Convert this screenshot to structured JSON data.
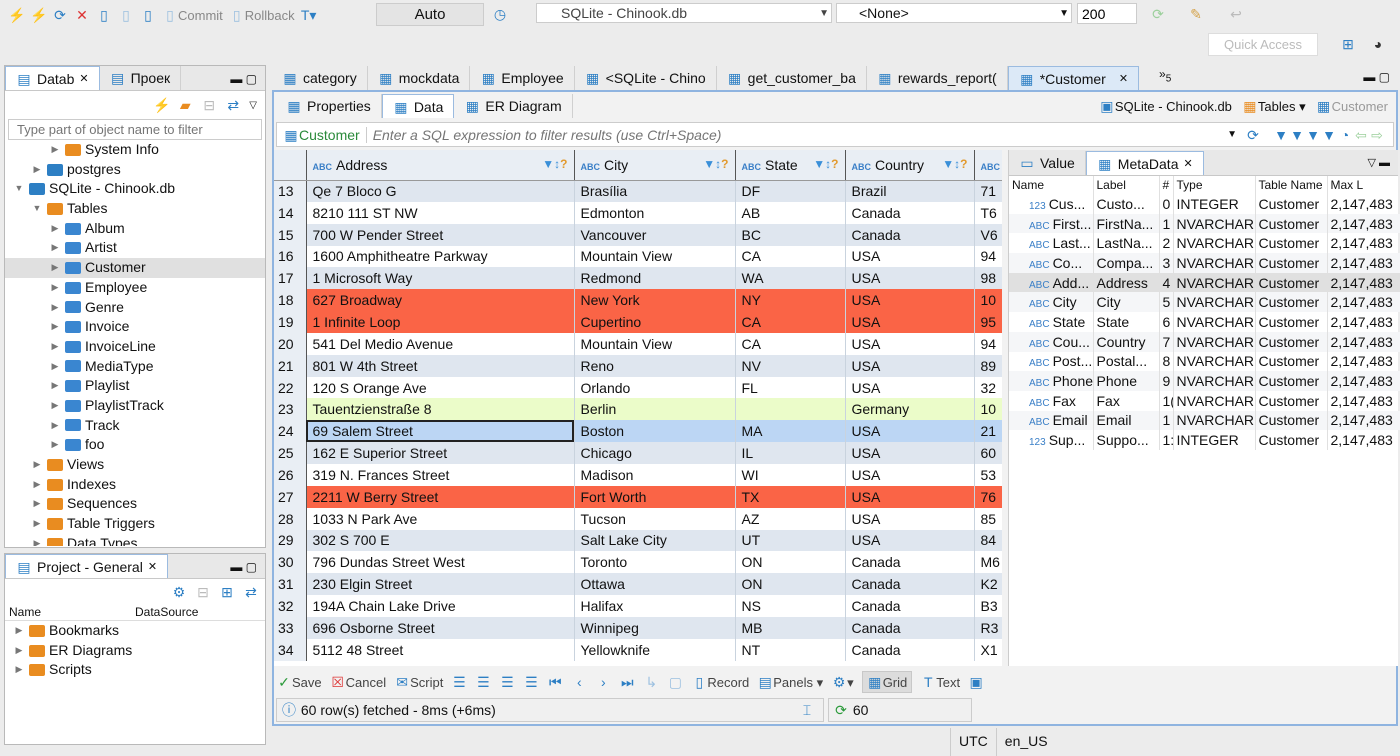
{
  "toolbar": {
    "commit": "Commit",
    "rollback": "Rollback",
    "mode": "Auto",
    "datasource": "SQLite - Chinook.db",
    "schema": "<None>",
    "limit": "200",
    "quick_access": "Quick Access"
  },
  "navigator": {
    "tab1": "Datab",
    "tab2": "Проек",
    "filter_placeholder": "Type part of object name to filter",
    "tree": [
      {
        "label": "System Info",
        "level": 2,
        "icon": "folder",
        "exp": "▶"
      },
      {
        "label": "postgres",
        "level": 1,
        "icon": "db",
        "exp": "▶"
      },
      {
        "label": "SQLite - Chinook.db",
        "level": 0,
        "icon": "db",
        "exp": "▼"
      },
      {
        "label": "Tables",
        "level": 1,
        "icon": "folder",
        "exp": "▼"
      },
      {
        "label": "Album",
        "level": 2,
        "icon": "table",
        "exp": "▶"
      },
      {
        "label": "Artist",
        "level": 2,
        "icon": "table",
        "exp": "▶"
      },
      {
        "label": "Customer",
        "level": 2,
        "icon": "table",
        "exp": "▶",
        "selected": true
      },
      {
        "label": "Employee",
        "level": 2,
        "icon": "table",
        "exp": "▶"
      },
      {
        "label": "Genre",
        "level": 2,
        "icon": "table",
        "exp": "▶"
      },
      {
        "label": "Invoice",
        "level": 2,
        "icon": "table",
        "exp": "▶"
      },
      {
        "label": "InvoiceLine",
        "level": 2,
        "icon": "table",
        "exp": "▶"
      },
      {
        "label": "MediaType",
        "level": 2,
        "icon": "table",
        "exp": "▶"
      },
      {
        "label": "Playlist",
        "level": 2,
        "icon": "table",
        "exp": "▶"
      },
      {
        "label": "PlaylistTrack",
        "level": 2,
        "icon": "table",
        "exp": "▶"
      },
      {
        "label": "Track",
        "level": 2,
        "icon": "table",
        "exp": "▶"
      },
      {
        "label": "foo",
        "level": 2,
        "icon": "table",
        "exp": "▶"
      },
      {
        "label": "Views",
        "level": 1,
        "icon": "view",
        "exp": "▶"
      },
      {
        "label": "Indexes",
        "level": 1,
        "icon": "folder",
        "exp": "▶"
      },
      {
        "label": "Sequences",
        "level": 1,
        "icon": "folder",
        "exp": "▶"
      },
      {
        "label": "Table Triggers",
        "level": 1,
        "icon": "folder",
        "exp": "▶"
      },
      {
        "label": "Data Types",
        "level": 1,
        "icon": "folder",
        "exp": "▶"
      }
    ]
  },
  "project": {
    "title": "Project - General",
    "col_name": "Name",
    "col_ds": "DataSource",
    "items": [
      "Bookmarks",
      "ER Diagrams",
      "Scripts"
    ]
  },
  "editor_tabs": [
    "category",
    "mockdata",
    "Employee",
    "<SQLite - Chino",
    "get_customer_ba",
    "rewards_report(",
    "*Customer"
  ],
  "editor_tabs_more": "5",
  "subtabs": [
    "Properties",
    "Data",
    "ER Diagram"
  ],
  "subtab_right": {
    "ds": "SQLite - Chinook.db",
    "tables": "Tables",
    "entity": "Customer"
  },
  "filter": {
    "entity": "Customer",
    "placeholder": "Enter a SQL expression to filter results (use Ctrl+Space)"
  },
  "grid": {
    "columns": [
      "Address",
      "City",
      "State",
      "Country",
      ""
    ],
    "row_colors": {
      "red": "#fa6446",
      "green": "#ebfcc9",
      "selected": "#bcd6f4"
    },
    "rows": [
      {
        "n": "13",
        "c": [
          "Qe 7 Bloco G",
          "Brasília",
          "DF",
          "Brazil",
          "71"
        ]
      },
      {
        "n": "14",
        "c": [
          "8210 111 ST NW",
          "Edmonton",
          "AB",
          "Canada",
          "T6"
        ]
      },
      {
        "n": "15",
        "c": [
          "700 W Pender Street",
          "Vancouver",
          "BC",
          "Canada",
          "V6"
        ]
      },
      {
        "n": "16",
        "c": [
          "1600 Amphitheatre Parkway",
          "Mountain View",
          "CA",
          "USA",
          "94"
        ]
      },
      {
        "n": "17",
        "c": [
          "1 Microsoft Way",
          "Redmond",
          "WA",
          "USA",
          "98"
        ]
      },
      {
        "n": "18",
        "c": [
          "627 Broadway",
          "New York",
          "NY",
          "USA",
          "10"
        ],
        "hl": "red"
      },
      {
        "n": "19",
        "c": [
          "1 Infinite Loop",
          "Cupertino",
          "CA",
          "USA",
          "95"
        ],
        "hl": "red"
      },
      {
        "n": "20",
        "c": [
          "541 Del Medio Avenue",
          "Mountain View",
          "CA",
          "USA",
          "94"
        ]
      },
      {
        "n": "21",
        "c": [
          "801 W 4th Street",
          "Reno",
          "NV",
          "USA",
          "89"
        ]
      },
      {
        "n": "22",
        "c": [
          "120 S Orange Ave",
          "Orlando",
          "FL",
          "USA",
          "32"
        ]
      },
      {
        "n": "23",
        "c": [
          "Tauentzienstraße 8",
          "Berlin",
          "",
          "Germany",
          "10"
        ],
        "hl": "green"
      },
      {
        "n": "24",
        "c": [
          "69 Salem Street",
          "Boston",
          "MA",
          "USA",
          "21"
        ],
        "hl": "selr"
      },
      {
        "n": "25",
        "c": [
          "162 E Superior Street",
          "Chicago",
          "IL",
          "USA",
          "60"
        ]
      },
      {
        "n": "26",
        "c": [
          "319 N. Frances Street",
          "Madison",
          "WI",
          "USA",
          "53"
        ]
      },
      {
        "n": "27",
        "c": [
          "2211 W Berry Street",
          "Fort Worth",
          "TX",
          "USA",
          "76"
        ],
        "hl": "red"
      },
      {
        "n": "28",
        "c": [
          "1033 N Park Ave",
          "Tucson",
          "AZ",
          "USA",
          "85"
        ]
      },
      {
        "n": "29",
        "c": [
          "302 S 700 E",
          "Salt Lake City",
          "UT",
          "USA",
          "84"
        ]
      },
      {
        "n": "30",
        "c": [
          "796 Dundas Street West",
          "Toronto",
          "ON",
          "Canada",
          "M6"
        ]
      },
      {
        "n": "31",
        "c": [
          "230 Elgin Street",
          "Ottawa",
          "ON",
          "Canada",
          "K2"
        ]
      },
      {
        "n": "32",
        "c": [
          "194A Chain Lake Drive",
          "Halifax",
          "NS",
          "Canada",
          "B3"
        ]
      },
      {
        "n": "33",
        "c": [
          "696 Osborne Street",
          "Winnipeg",
          "MB",
          "Canada",
          "R3"
        ]
      },
      {
        "n": "34",
        "c": [
          "5112 48 Street",
          "Yellowknife",
          "NT",
          "Canada",
          "X1"
        ]
      }
    ]
  },
  "side_panel": {
    "tab_value": "Value",
    "tab_meta": "MetaData",
    "columns": [
      "Name",
      "Label",
      "#",
      "Type",
      "Table Name",
      "Max L"
    ],
    "rows": [
      {
        "t": "123",
        "c": [
          "Cus...",
          "Custo...",
          "0",
          "INTEGER",
          "Customer",
          "2,147,483"
        ]
      },
      {
        "t": "ABC",
        "c": [
          "First...",
          "FirstNa...",
          "1",
          "NVARCHAR",
          "Customer",
          "2,147,483"
        ]
      },
      {
        "t": "ABC",
        "c": [
          "Last...",
          "LastNa...",
          "2",
          "NVARCHAR",
          "Customer",
          "2,147,483"
        ]
      },
      {
        "t": "ABC",
        "c": [
          "Co...",
          "Compa...",
          "3",
          "NVARCHAR",
          "Customer",
          "2,147,483"
        ]
      },
      {
        "t": "ABC",
        "c": [
          "Add...",
          "Address",
          "4",
          "NVARCHAR",
          "Customer",
          "2,147,483"
        ],
        "sel": true
      },
      {
        "t": "ABC",
        "c": [
          "City",
          "City",
          "5",
          "NVARCHAR",
          "Customer",
          "2,147,483"
        ]
      },
      {
        "t": "ABC",
        "c": [
          "State",
          "State",
          "6",
          "NVARCHAR",
          "Customer",
          "2,147,483"
        ]
      },
      {
        "t": "ABC",
        "c": [
          "Cou...",
          "Country",
          "7",
          "NVARCHAR",
          "Customer",
          "2,147,483"
        ]
      },
      {
        "t": "ABC",
        "c": [
          "Post...",
          "Postal...",
          "8",
          "NVARCHAR",
          "Customer",
          "2,147,483"
        ]
      },
      {
        "t": "ABC",
        "c": [
          "Phone",
          "Phone",
          "9",
          "NVARCHAR",
          "Customer",
          "2,147,483"
        ]
      },
      {
        "t": "ABC",
        "c": [
          "Fax",
          "Fax",
          "1(",
          "NVARCHAR",
          "Customer",
          "2,147,483"
        ]
      },
      {
        "t": "ABC",
        "c": [
          "Email",
          "Email",
          "1",
          "NVARCHAR",
          "Customer",
          "2,147,483"
        ]
      },
      {
        "t": "123",
        "c": [
          "Sup...",
          "Suppo...",
          "1:",
          "INTEGER",
          "Customer",
          "2,147,483"
        ]
      }
    ]
  },
  "bottom": {
    "save": "Save",
    "cancel": "Cancel",
    "script": "Script",
    "record": "Record",
    "panels": "Panels",
    "grid": "Grid",
    "text": "Text",
    "status": "60 row(s) fetched - 8ms (+6ms)",
    "count": "60"
  },
  "statusbar": {
    "tz": "UTC",
    "locale": "en_US"
  }
}
